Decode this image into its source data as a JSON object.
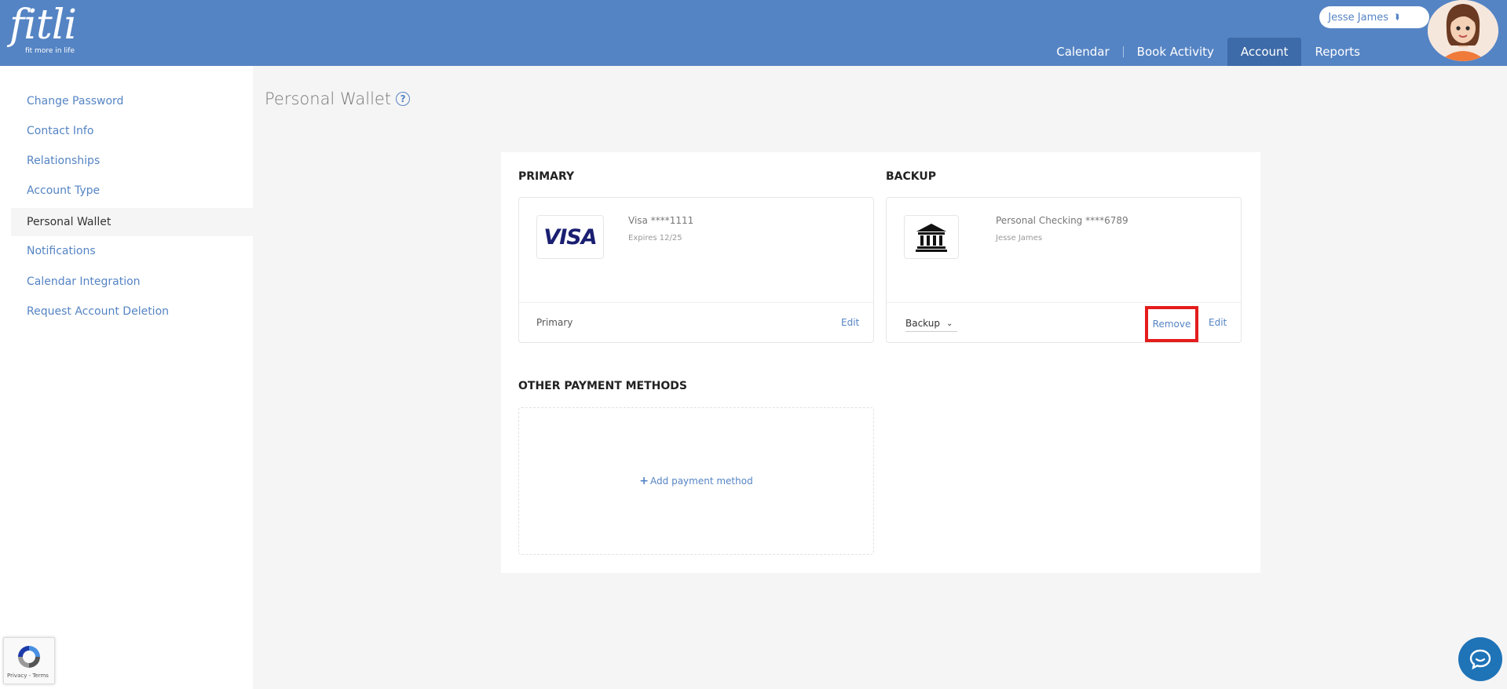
{
  "header": {
    "logo": {
      "word": "fitli",
      "tagline": "fit more in life"
    },
    "user_name": "Jesse James",
    "nav": [
      {
        "label": "Calendar",
        "active": false
      },
      {
        "label": "Book Activity",
        "active": false
      },
      {
        "label": "Account",
        "active": true
      },
      {
        "label": "Reports",
        "active": false
      }
    ]
  },
  "sidebar": {
    "items": [
      {
        "label": "Change Password",
        "active": false
      },
      {
        "label": "Contact Info",
        "active": false
      },
      {
        "label": "Relationships",
        "active": false
      },
      {
        "label": "Account Type",
        "active": false
      },
      {
        "label": "Personal Wallet",
        "active": true
      },
      {
        "label": "Notifications",
        "active": false
      },
      {
        "label": "Calendar Integration",
        "active": false
      },
      {
        "label": "Request Account Deletion",
        "active": false
      }
    ]
  },
  "page": {
    "title": "Personal Wallet",
    "help_glyph": "?"
  },
  "wallet": {
    "primary": {
      "section_label": "PRIMARY",
      "logo_text": "VISA",
      "line1": "Visa ****1111",
      "line2": "Expires 12/25",
      "footer_label": "Primary",
      "edit_label": "Edit"
    },
    "backup": {
      "section_label": "BACKUP",
      "icon": "bank-icon",
      "line1": "Personal Checking ****6789",
      "line2": "Jesse James",
      "select_value": "Backup",
      "remove_label": "Remove",
      "edit_label": "Edit"
    },
    "other": {
      "section_label": "OTHER PAYMENT METHODS",
      "add_label": "Add payment method"
    }
  },
  "widgets": {
    "recaptcha_text": "Privacy - Terms"
  },
  "colors": {
    "header": "#5584c4",
    "nav_active": "#3d6aa8",
    "link": "#5584c4",
    "highlight": "#e41c1c",
    "chat": "#1f73b7"
  }
}
